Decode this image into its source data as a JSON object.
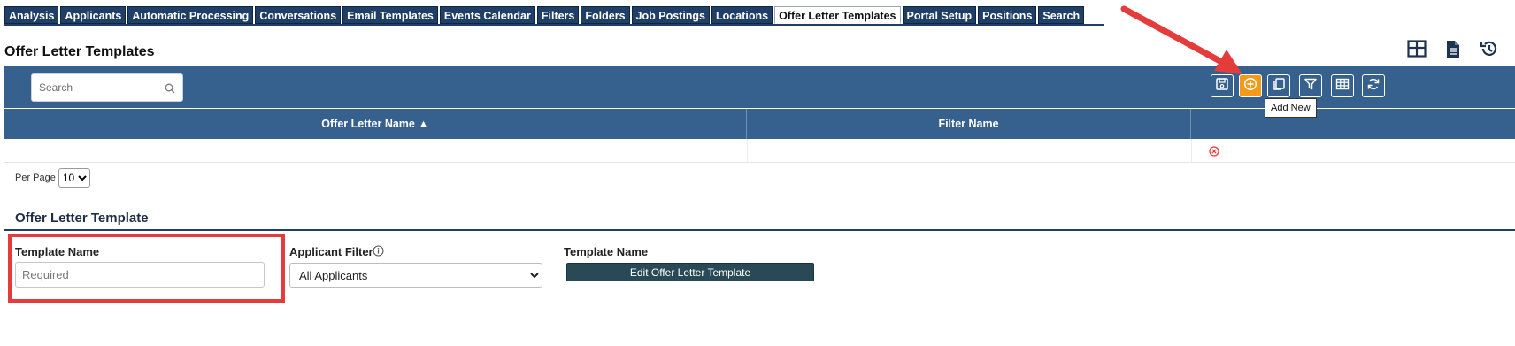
{
  "tabs": [
    {
      "label": "Analysis",
      "active": false
    },
    {
      "label": "Applicants",
      "active": false
    },
    {
      "label": "Automatic Processing",
      "active": false
    },
    {
      "label": "Conversations",
      "active": false
    },
    {
      "label": "Email Templates",
      "active": false
    },
    {
      "label": "Events Calendar",
      "active": false
    },
    {
      "label": "Filters",
      "active": false
    },
    {
      "label": "Folders",
      "active": false
    },
    {
      "label": "Job Postings",
      "active": false
    },
    {
      "label": "Locations",
      "active": false
    },
    {
      "label": "Offer Letter Templates",
      "active": true
    },
    {
      "label": "Portal Setup",
      "active": false
    },
    {
      "label": "Positions",
      "active": false
    },
    {
      "label": "Search",
      "active": false
    }
  ],
  "page": {
    "title": "Offer Letter Templates"
  },
  "toolbar": {
    "search_placeholder": "Search",
    "tooltip": "Add New",
    "buttons": [
      "save-icon",
      "add-new-icon",
      "copy-icon",
      "filter-icon",
      "grid-icon",
      "refresh-icon"
    ]
  },
  "grid": {
    "columns": [
      "Offer Letter Name ▲",
      "Filter Name",
      ""
    ]
  },
  "pagination": {
    "per_page_label": "Per Page",
    "per_page_value": "10"
  },
  "form": {
    "section_title": "Offer Letter Template",
    "template_name_label": "Template Name",
    "template_name_placeholder": "Required",
    "applicant_filter_label": "Applicant Filter",
    "applicant_filter_value": "All Applicants",
    "template_name_label2": "Template Name",
    "edit_button": "Edit Offer Letter Template"
  },
  "colors": {
    "header_blue": "#36618e",
    "tab_blue": "#1f3f66",
    "accent_orange": "#f39a1b",
    "highlight_red": "#e43b3b"
  }
}
